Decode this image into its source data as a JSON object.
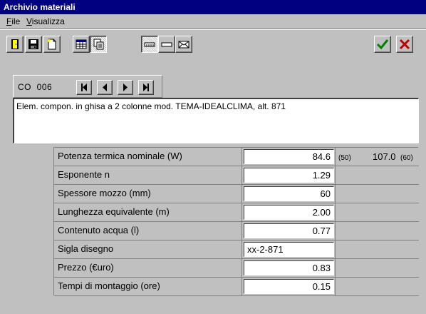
{
  "window": {
    "title": "Archivio materiali"
  },
  "menu": {
    "file": "File",
    "view": "Visualizza"
  },
  "toolbar": {
    "icons": [
      "door-exit-icon",
      "floppy-save-icon",
      "new-document-icon",
      "table-grid-icon",
      "copy-document-icon",
      "row-view-icon",
      "line-view-icon",
      "envelope-view-icon",
      "confirm-check-icon",
      "cancel-x-icon"
    ]
  },
  "record": {
    "code": "CO  006"
  },
  "description": "Elem. compon. in ghisa a 2 colonne  mod. TEMA-IDEALCLIMA, alt. 871",
  "fields": [
    {
      "label": "Potenza termica nominale (W)",
      "value": "84.6",
      "delta_left": "(50)",
      "extra_value": "107.0",
      "delta_right": "(60)"
    },
    {
      "label": "Esponente n",
      "value": "1.29"
    },
    {
      "label": "Spessore mozzo (mm)",
      "value": "60"
    },
    {
      "label": "Lunghezza equivalente (m)",
      "value": "2.00"
    },
    {
      "label": "Contenuto acqua (l)",
      "value": "0.77"
    },
    {
      "label": "Sigla disegno",
      "value": "xx-2-871"
    },
    {
      "label": "Prezzo (€uro)",
      "value": "0.83"
    },
    {
      "label": "Tempi di montaggio (ore)",
      "value": "0.15"
    }
  ],
  "colors": {
    "title_bar": "#000080",
    "face": "#c0c0c0",
    "check": "#008000",
    "cancel": "#c00000"
  }
}
